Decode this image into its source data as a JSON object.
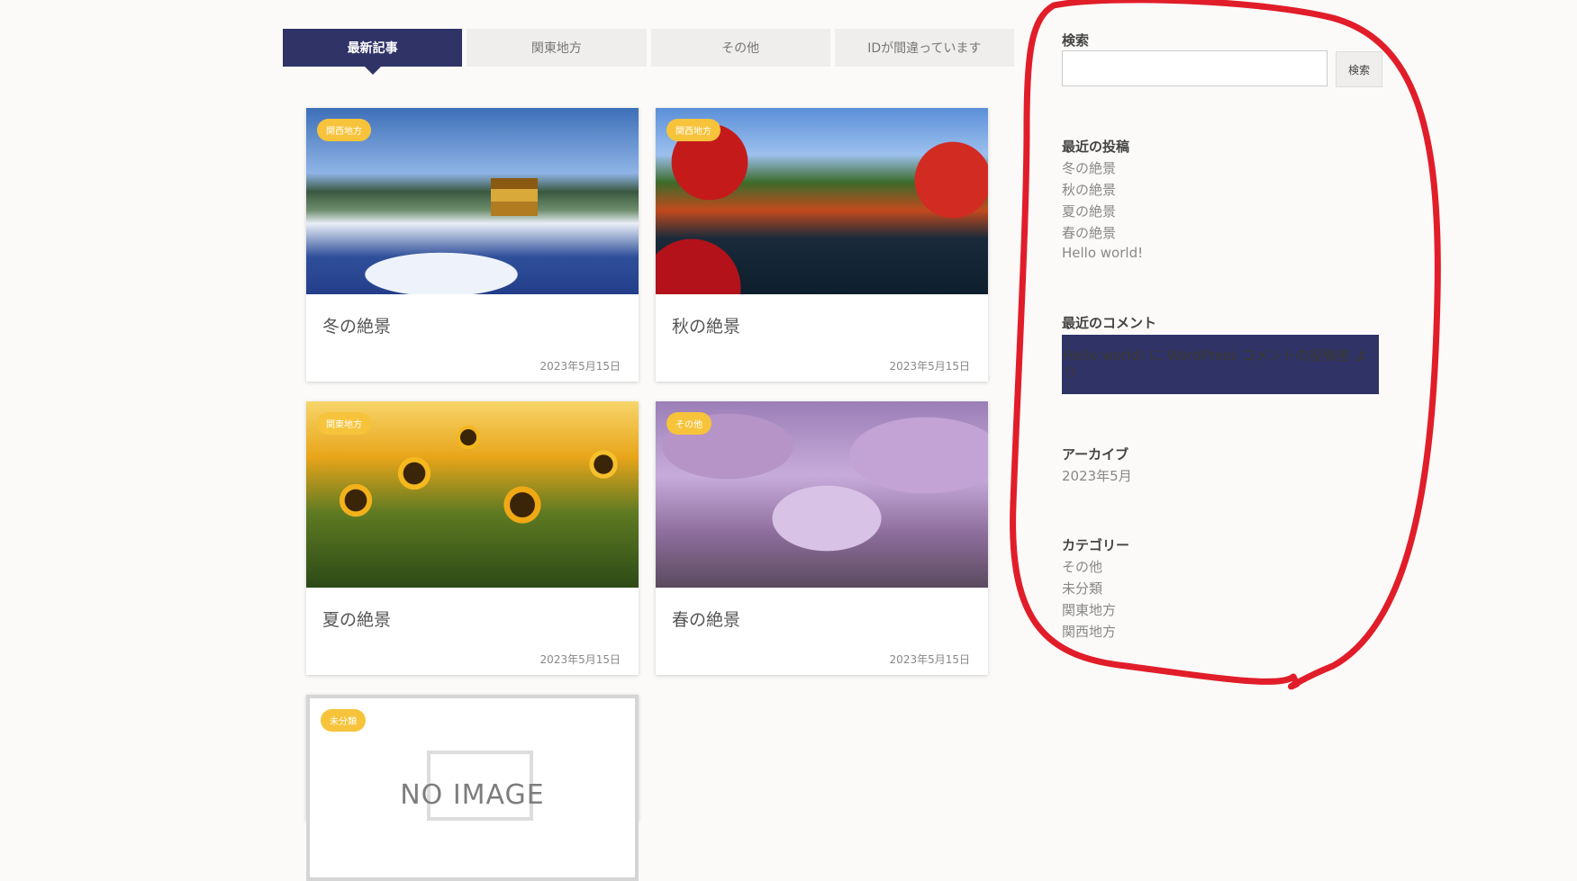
{
  "tabs": [
    {
      "label": "最新記事",
      "active": true
    },
    {
      "label": "関東地方",
      "active": false
    },
    {
      "label": "その他",
      "active": false
    },
    {
      "label": "IDが間違っています",
      "active": false
    }
  ],
  "posts": [
    {
      "title": "冬の絶景",
      "date": "2023年5月15日",
      "category": "関西地方"
    },
    {
      "title": "秋の絶景",
      "date": "2023年5月15日",
      "category": "関西地方"
    },
    {
      "title": "夏の絶景",
      "date": "2023年5月15日",
      "category": "関東地方"
    },
    {
      "title": "春の絶景",
      "date": "2023年5月15日",
      "category": "その他"
    },
    {
      "title": "",
      "date": "",
      "category": "未分類",
      "no_image_text": "NO IMAGE"
    }
  ],
  "sidebar": {
    "search": {
      "title": "検索",
      "value": "",
      "button_label": "検索"
    },
    "recent_posts": {
      "title": "最近の投稿",
      "items": [
        "冬の絶景",
        "秋の絶景",
        "夏の絶景",
        "春の絶景",
        "Hello world!"
      ]
    },
    "recent_comments": {
      "title": "最近のコメント",
      "text": "Hello world! に WordPress コメントの投稿者 より"
    },
    "archives": {
      "title": "アーカイブ",
      "items": [
        "2023年5月"
      ]
    },
    "categories": {
      "title": "カテゴリー",
      "items": [
        "その他",
        "未分類",
        "関東地方",
        "関西地方"
      ]
    }
  },
  "colors": {
    "accent": "#2f3366",
    "badge": "#f6c33b",
    "annotation": "#e11d2a"
  }
}
